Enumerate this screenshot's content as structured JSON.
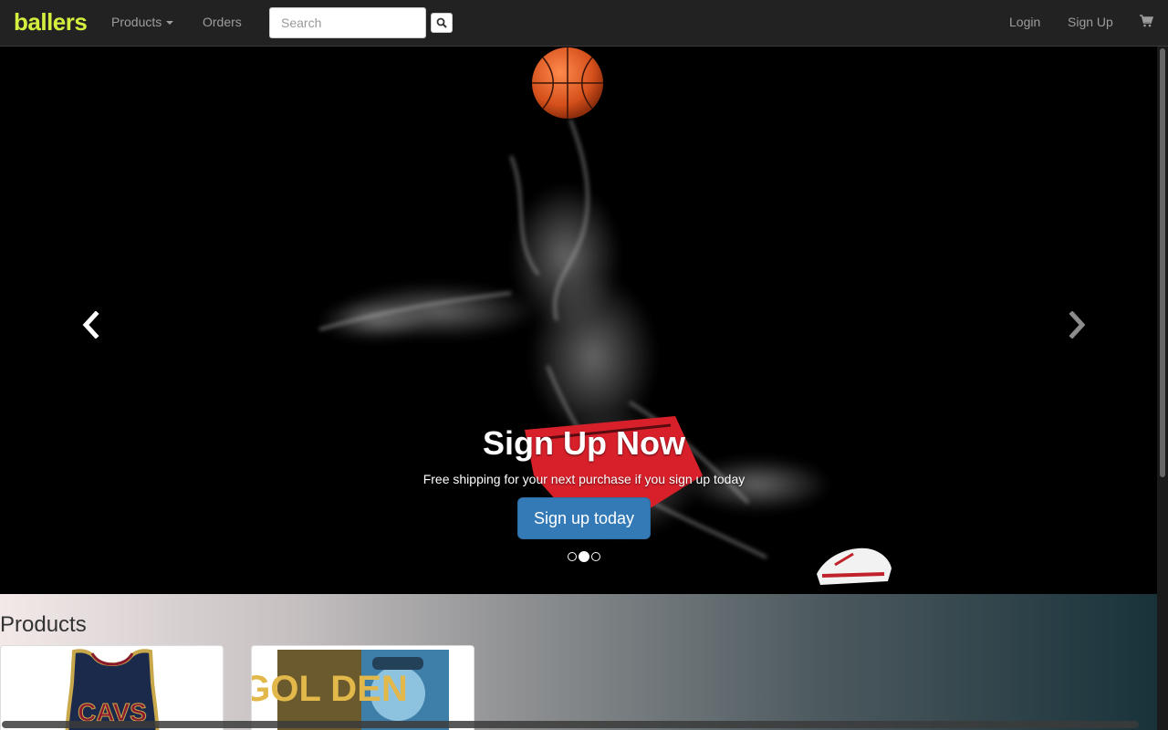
{
  "navbar": {
    "brand": "ballers",
    "products_label": "Products",
    "orders_label": "Orders",
    "search_placeholder": "Search",
    "login_label": "Login",
    "signup_label": "Sign Up"
  },
  "carousel": {
    "title": "Sign Up Now",
    "subtitle": "Free shipping for your next purchase if you sign up today",
    "button_label": "Sign up today",
    "slide_count": 3,
    "active_slide": 2
  },
  "products": {
    "heading": "Products",
    "items": [
      {
        "name": "cavs-jersey",
        "image_text": "CAVS"
      },
      {
        "name": "golden-poster",
        "image_text": "GOL DEN"
      }
    ]
  },
  "colors": {
    "brand": "#d6ef3f",
    "navbar_bg": "#222222",
    "primary_button": "#337ab7",
    "jersey_navy": "#1b2a4a",
    "jersey_wine": "#8b1a2e"
  }
}
